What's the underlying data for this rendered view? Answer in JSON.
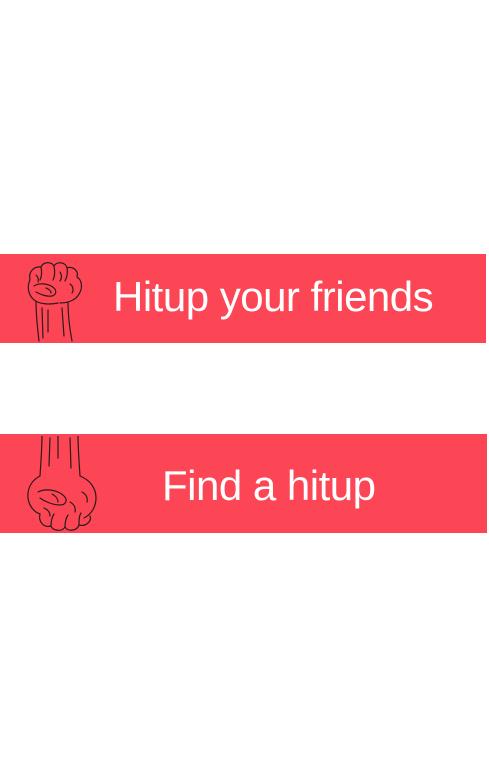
{
  "buttons": {
    "hitup_friends": {
      "label": "Hitup your friends",
      "icon": "raised-fist-icon"
    },
    "find_hitup": {
      "label": "Find a hitup",
      "icon": "lowered-fist-icon"
    }
  },
  "colors": {
    "button_background": "#fd4655",
    "button_text": "#ffffff",
    "page_background": "#ffffff"
  }
}
